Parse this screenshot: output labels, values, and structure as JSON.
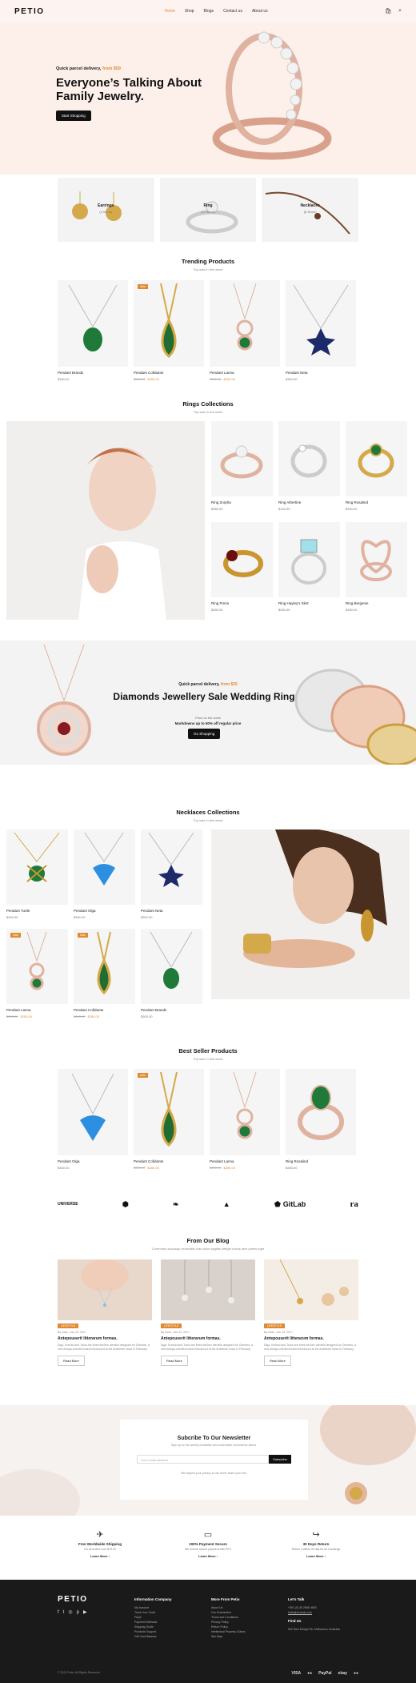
{
  "header": {
    "logo": "PETIO",
    "nav": [
      "Home",
      "Shop",
      "Blogs",
      "Contact us",
      "About us"
    ]
  },
  "hero": {
    "sub": "Quick parcel delivery,",
    "sub_price": "from $59",
    "title": "Everyone’s Talking About Family Jewelry.",
    "button": "Start Shopping"
  },
  "categories": [
    {
      "name": "Earrings",
      "count": "(2 Items)"
    },
    {
      "name": "Ring",
      "count": "(12 Items)"
    },
    {
      "name": "Necklaces",
      "count": "(8 Items)"
    }
  ],
  "trending": {
    "title": "Trending Products",
    "sub": "Top sale in this week",
    "items": [
      {
        "name": "Pendant Brands",
        "price": "$300.00",
        "old": "",
        "badge": ""
      },
      {
        "name": "Pendant Cofidante",
        "price": "$280.00",
        "old": "$300.00",
        "badge": "Sale"
      },
      {
        "name": "Pendant Lanna",
        "price": "$250.00",
        "old": "$300.00",
        "badge": ""
      },
      {
        "name": "Pendant Neta",
        "price": "$300.00",
        "old": "",
        "badge": ""
      }
    ]
  },
  "rings": {
    "title": "Rings Collections",
    "sub": "Top sale in the week",
    "items": [
      {
        "name": "Ring Zorpha",
        "price": "$360.00"
      },
      {
        "name": "Ring Athertine",
        "price": "$140.00"
      },
      {
        "name": "Ring Rosalind",
        "price": "$300.00"
      },
      {
        "name": "Ring Freza",
        "price": "$280.00"
      },
      {
        "name": "Ring Hayley's Skirt",
        "price": "$260.00"
      },
      {
        "name": "Ring Bergenie",
        "price": "$300.00"
      }
    ]
  },
  "promo": {
    "sub": "Quick parcel delivery,",
    "sub_price": "from $25",
    "title": "Diamonds Jewellery Sale Wedding Rings.",
    "t1": "Price on the week",
    "t2": "Markdowns up to 50% off regular price",
    "button": "Go Shopping"
  },
  "necklaces": {
    "title": "Necklaces Collections",
    "sub": "Top sale in this week",
    "items": [
      {
        "name": "Pendant Turtle",
        "price": "$400.00",
        "old": "",
        "badge": ""
      },
      {
        "name": "Pendant Olga",
        "price": "$300.00",
        "old": "",
        "badge": ""
      },
      {
        "name": "Pendant Neta",
        "price": "$300.00",
        "old": "",
        "badge": ""
      },
      {
        "name": "Pendant Lanna",
        "price": "$250.00",
        "old": "$300.00",
        "badge": "Sale"
      },
      {
        "name": "Pendant Cofidante",
        "price": "$280.00",
        "old": "$300.00",
        "badge": "Sale"
      },
      {
        "name": "Pendant Brands",
        "price": "$300.00",
        "old": "",
        "badge": ""
      }
    ]
  },
  "bestseller": {
    "title": "Best Seller Products",
    "sub": "Top sale in this week",
    "items": [
      {
        "name": "Pendant Olga",
        "price": "$300.00",
        "old": "",
        "badge": ""
      },
      {
        "name": "Pendant Cofidante",
        "price": "$280.00",
        "old": "$300.00",
        "badge": "Sale"
      },
      {
        "name": "Pendant Lanna",
        "price": "$250.00",
        "old": "$300.00",
        "badge": ""
      },
      {
        "name": "Ring Rosalind",
        "price": "$300.00",
        "old": "",
        "badge": ""
      }
    ]
  },
  "brands": [
    "UNIVERSE",
    "GitLab",
    "ra"
  ],
  "blog": {
    "title": "From Our Blog",
    "sub": "Commodo sociosqu venenatis cras dolor sagittis integer luctus sem primis eget",
    "posts": [
      {
        "tag": "LIFESTYLE",
        "meta": "By Isaia - Jan 23, 2017",
        "title": "Antepouserit litterarum formas.",
        "excerpt": "Diga, Konrad and Torus are three kitchen utensils designed for Ohmhes, a new design-oriented brand introduced at the Ambiente show in February.",
        "more": "Read More"
      },
      {
        "tag": "LIFESTYLE",
        "meta": "By Isaia - Jan 23, 2017",
        "title": "Antepouserit litterarum formas.",
        "excerpt": "Diga, Konrad and Torus are three kitchen utensils designed for Ohmhes, a new design-oriented brand introduced at the Ambiente show in February.",
        "more": "Read More"
      },
      {
        "tag": "LIFESTYLE",
        "meta": "By Isaia - Jan 23, 2017",
        "title": "Antepouserit litterarum formas.",
        "excerpt": "Diga, Konrad and Torus are three kitchen utensils designed for Ohmhes, a new design-oriented brand introduced at the Ambiente show in February.",
        "more": "Read More"
      }
    ]
  },
  "newsletter": {
    "title": "Subcribe To Our Newsletter",
    "desc": "Sign up for the weekly newsletter and build better ecommerce stores.",
    "placeholder": "Your email address",
    "button": "Subscribe",
    "note": "We respect your privacy so we never share your info."
  },
  "features": [
    {
      "title": "Free Worldwide Shipping",
      "sub": "On all orders over $75.00",
      "link": "Learn More"
    },
    {
      "title": "100% Payment Secure",
      "sub": "We ensure secure payment with PEV",
      "link": "Learn More"
    },
    {
      "title": "30 Days Return",
      "sub": "Return it within 30 day for an exchange",
      "link": "Learn More"
    }
  ],
  "footer": {
    "logo": "PETIO",
    "info_title": "Information Company",
    "info": [
      "My Account",
      "Track Your Order",
      "FAQs",
      "Payment Methods",
      "Shipping Guide",
      "Products Support",
      "Gift Card Balance"
    ],
    "more_title": "More From Petio",
    "more": [
      "About Us",
      "Our Guarantees",
      "Terms and Conditions",
      "Privacy Policy",
      "Return Policy",
      "Intellectual Property Claims",
      "Site Map"
    ],
    "talk_title": "Let's Talk",
    "phone": "+391 (0) 35 2568 4593",
    "email": "hello@domain.com",
    "find_title": "Find Us",
    "address": "502 New Design Str, Melbourne, Australia",
    "copyright": "© 2021 Petio. All Rights Reserved",
    "payments": [
      "VISA",
      "PayPal",
      "ebay"
    ]
  }
}
